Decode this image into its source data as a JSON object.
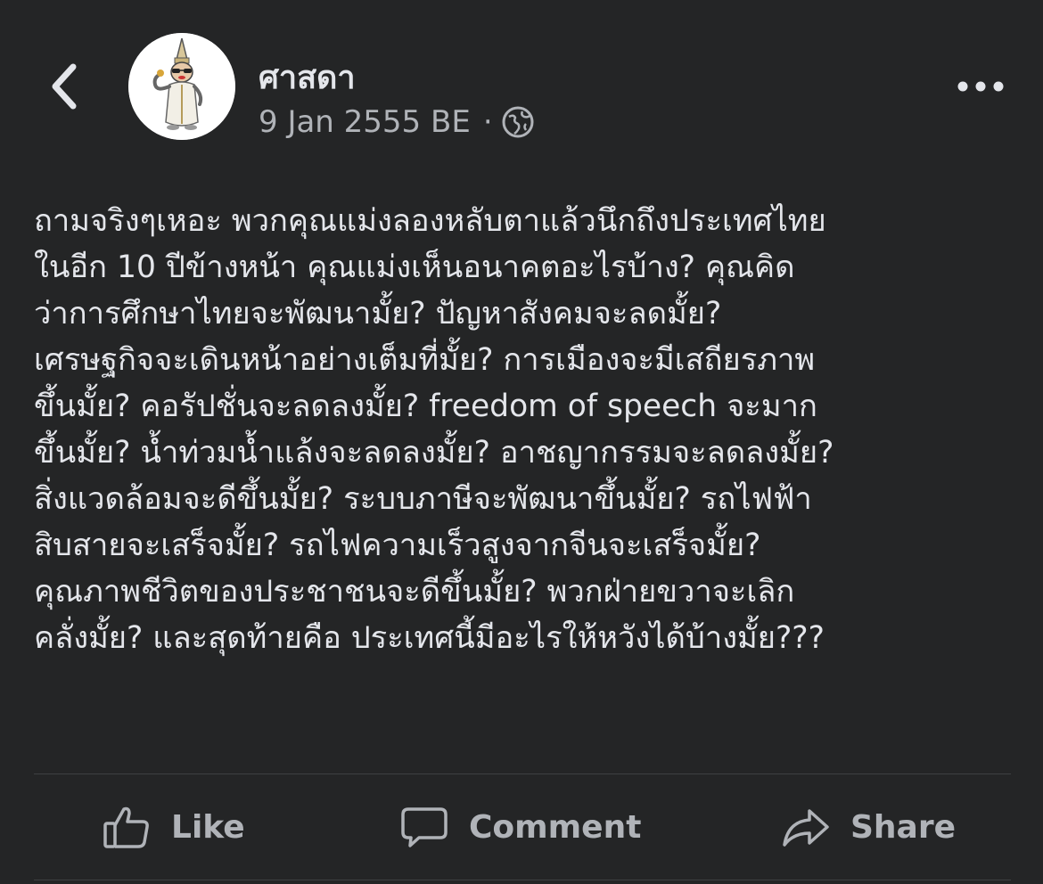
{
  "post": {
    "author": "ศาสดา",
    "date": "9 Jan 2555 BE",
    "separator": "·",
    "privacy_icon": "globe-icon",
    "text_lines": [
      "ถามจริงๆเหอะ พวกคุณแม่งลองหลับตาแล้วนึกถึงประเทศไทย",
      "ในอีก 10 ปีข้างหน้า คุณแม่งเห็นอนาคตอะไรบ้าง? คุณคิด",
      "ว่าการศึกษาไทยจะพัฒนามั้ย? ปัญหาสังคมจะลดมั้ย?",
      "เศรษฐกิจจะเดินหน้าอย่างเต็มที่มั้ย? การเมืองจะมีเสถียรภาพ",
      "ขึ้นมั้ย? คอรัปชั่นจะลดลงมั้ย? freedom of speech จะมาก",
      "ขึ้นมั้ย? น้ำท่วมน้ำแล้งจะลดลงมั้ย? อาชญากรรมจะลดลงมั้ย?",
      "สิ่งแวดล้อมจะดีขึ้นมั้ย? ระบบภาษีจะพัฒนาขึ้นมั้ย? รถไฟฟ้า",
      "สิบสายจะเสร็จมั้ย? รถไฟความเร็วสูงจากจีนจะเสร็จมั้ย?",
      "คุณภาพชีวิตของประชาชนจะดีขึ้นมั้ย? พวกฝ่ายขวาจะเลิก",
      "คลั่งมั้ย? และสุดท้ายคือ ประเทศนี้มีอะไรให้หวังได้บ้างมั้ย???"
    ]
  },
  "actions": {
    "like_label": "Like",
    "comment_label": "Comment",
    "share_label": "Share"
  },
  "icons": {
    "back": "chevron-left-icon",
    "more": "more-options-icon",
    "like": "thumbs-up-icon",
    "comment": "comment-bubble-icon",
    "share": "share-arrow-icon"
  },
  "colors": {
    "background": "#242526",
    "primary_text": "#e4e6eb",
    "secondary_text": "#b0b3b8",
    "divider": "#3e4042"
  }
}
